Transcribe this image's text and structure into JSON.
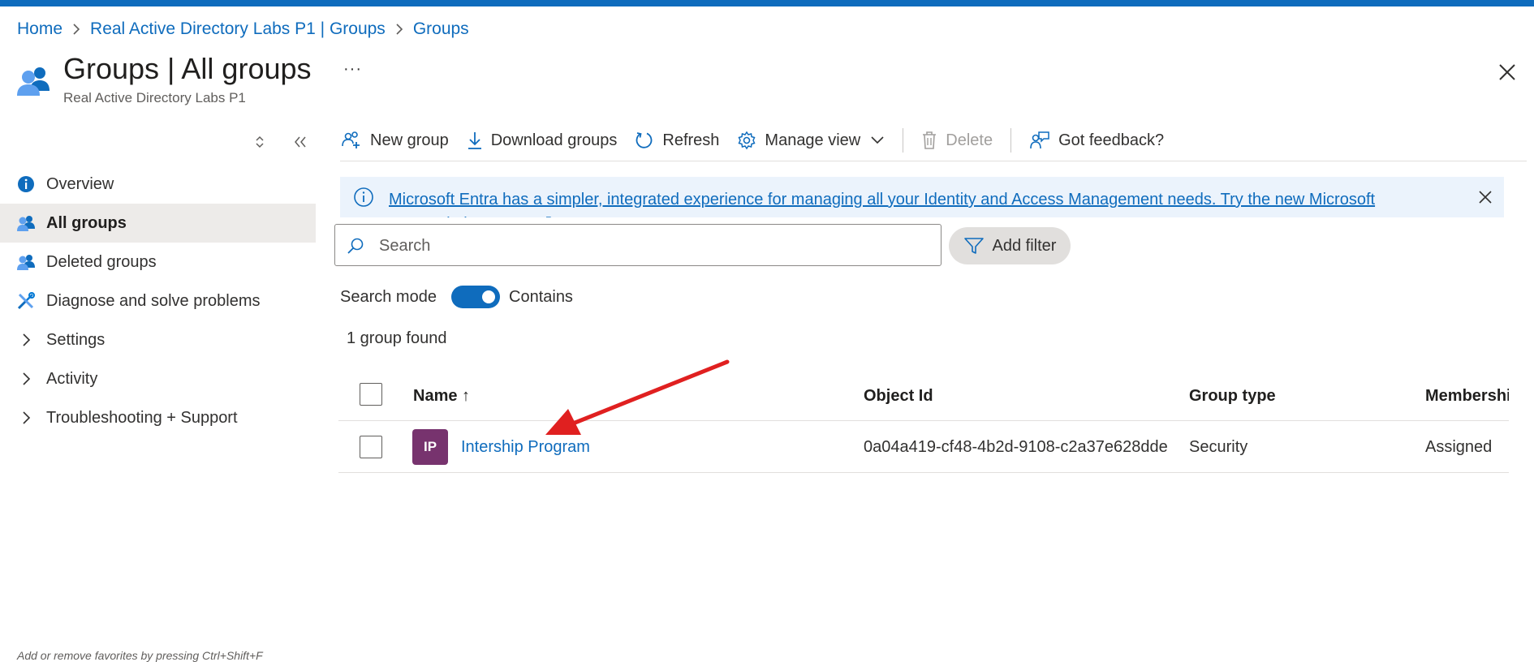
{
  "breadcrumb": [
    {
      "label": "Home"
    },
    {
      "label": "Real Active Directory Labs P1 | Groups"
    },
    {
      "label": "Groups"
    }
  ],
  "header": {
    "title": "Groups | All groups",
    "subtitle": "Real Active Directory Labs P1",
    "more_label": "···"
  },
  "sidebar": {
    "items": [
      {
        "label": "Overview",
        "icon": "info-icon"
      },
      {
        "label": "All groups",
        "icon": "people-icon",
        "active": true
      },
      {
        "label": "Deleted groups",
        "icon": "people-icon"
      },
      {
        "label": "Diagnose and solve problems",
        "icon": "wrench-icon"
      },
      {
        "label": "Settings",
        "icon": "chevron-right-icon"
      },
      {
        "label": "Activity",
        "icon": "chevron-right-icon"
      },
      {
        "label": "Troubleshooting + Support",
        "icon": "chevron-right-icon"
      }
    ],
    "footer_hint": "Add or remove favorites by pressing Ctrl+Shift+F"
  },
  "toolbar": {
    "new_group": "New group",
    "download_groups": "Download groups",
    "refresh": "Refresh",
    "manage_view": "Manage view",
    "delete": "Delete",
    "feedback": "Got feedback?"
  },
  "banner": {
    "text": "Microsoft Entra has a simpler, integrated experience for managing all your Identity and Access Management needs. Try the new Microsoft Entra admin center."
  },
  "search": {
    "placeholder": "Search",
    "value": "",
    "add_filter": "Add filter",
    "mode_label": "Search mode",
    "mode_value": "Contains",
    "mode_on": true
  },
  "results": {
    "count_text": "1 group found"
  },
  "table": {
    "columns": [
      "Name ↑",
      "Object Id",
      "Group type",
      "Membership type"
    ],
    "rows": [
      {
        "initials": "IP",
        "name": "Intership Program",
        "object_id": "0a04a419-cf48-4b2d-9108-c2a37e628dde",
        "group_type": "Security",
        "membership": "Assigned"
      }
    ]
  },
  "colors": {
    "accent": "#0f6cbd",
    "avatar": "#77336e",
    "annotation_arrow": "#e02020",
    "banner_bg": "#ebf3fc"
  }
}
